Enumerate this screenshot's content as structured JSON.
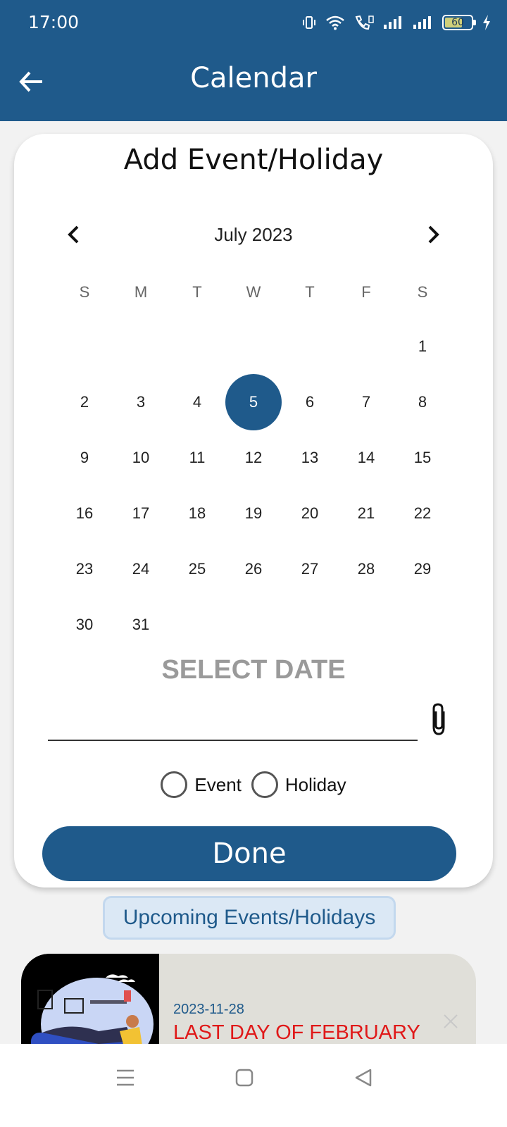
{
  "status_bar": {
    "time": "17:00",
    "battery_level": "60",
    "icons": [
      "vibrate-icon",
      "wifi-icon",
      "wifi-call-icon",
      "signal-icon",
      "signal-icon",
      "battery-icon",
      "charging-icon"
    ]
  },
  "app_bar": {
    "title": "Calendar",
    "back_icon": "arrow-left-icon"
  },
  "card": {
    "title": "Add Event/Holiday",
    "calendar": {
      "month_label": "July 2023",
      "weekdays": [
        "S",
        "M",
        "T",
        "W",
        "T",
        "F",
        "S"
      ],
      "leading_blanks": 6,
      "days": [
        "1",
        "2",
        "3",
        "4",
        "5",
        "6",
        "7",
        "8",
        "9",
        "10",
        "11",
        "12",
        "13",
        "14",
        "15",
        "16",
        "17",
        "18",
        "19",
        "20",
        "21",
        "22",
        "23",
        "24",
        "25",
        "26",
        "27",
        "28",
        "29",
        "30",
        "31"
      ],
      "selected_day": "5"
    },
    "select_date_label": "SELECT DATE",
    "date_input_value": "",
    "attach_icon": "paperclip-icon",
    "radio_options": [
      {
        "label": "Event",
        "checked": false
      },
      {
        "label": "Holiday",
        "checked": false
      }
    ],
    "done_label": "Done"
  },
  "upcoming_label": "Upcoming Events/Holidays",
  "event": {
    "date": "2023-11-28",
    "title": "LAST DAY OF FEBRUARY"
  },
  "colors": {
    "primary": "#1f5a8b",
    "event_title": "#e01919",
    "muted": "#9a9a9a"
  }
}
